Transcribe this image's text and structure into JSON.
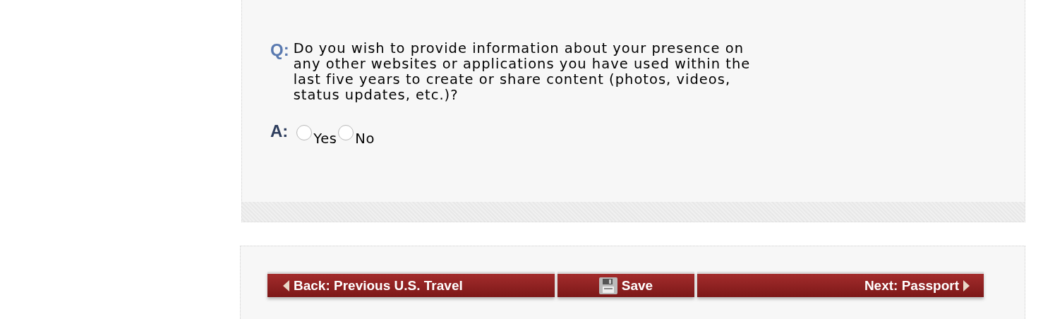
{
  "question": {
    "label": "Q:",
    "text": "Do you wish to provide information about your presence on any other websites or applications you have used within the last five years to create or share content (photos, videos, status updates, etc.)?"
  },
  "answer": {
    "label": "A:",
    "options": [
      {
        "label": "Yes",
        "selected": false
      },
      {
        "label": "No",
        "selected": false
      }
    ]
  },
  "navigation": [
    {
      "kind": "back",
      "label": "Back: Previous U.S. Travel"
    },
    {
      "kind": "save",
      "label": "Save"
    },
    {
      "kind": "next",
      "label": "Next: Passport"
    }
  ]
}
